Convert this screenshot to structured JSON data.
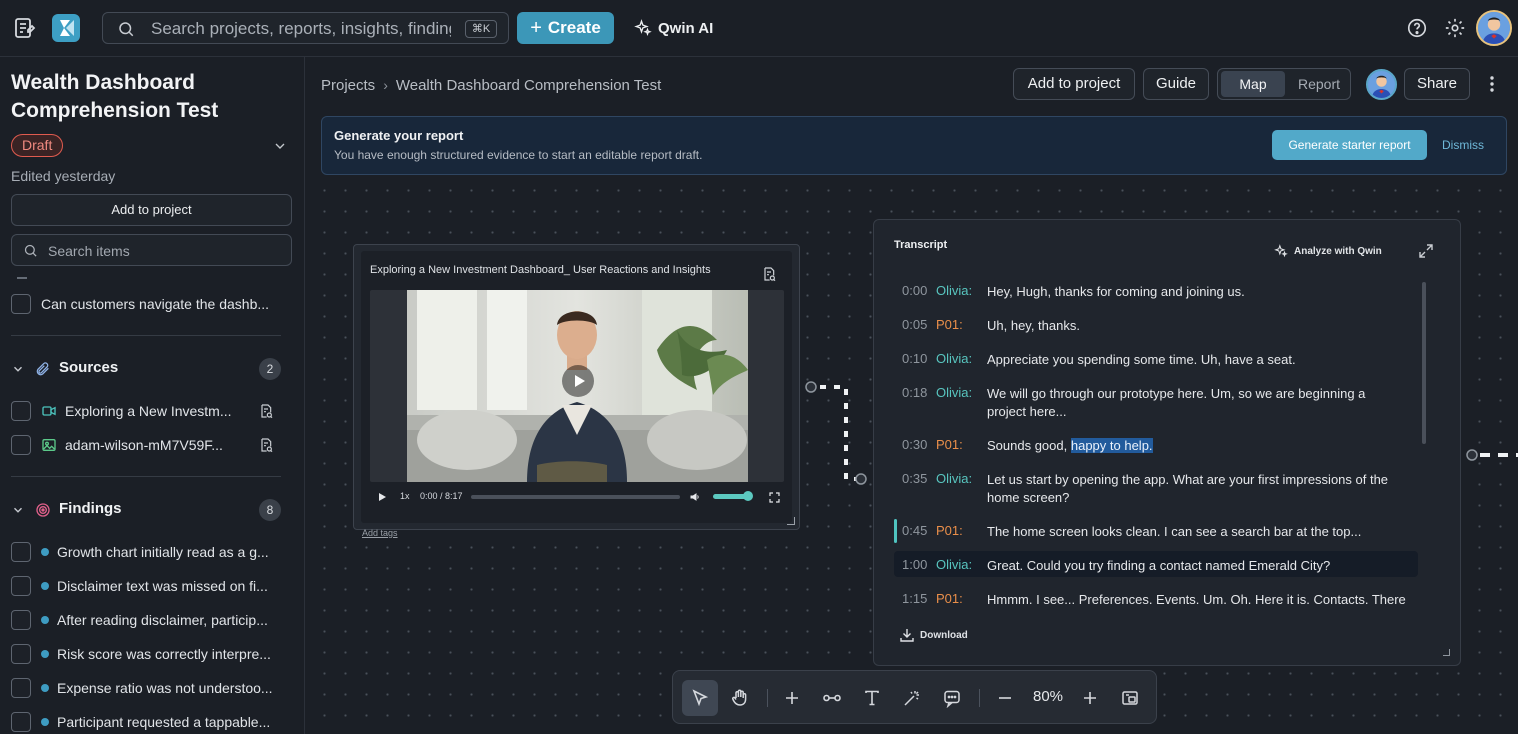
{
  "topbar": {
    "search_placeholder": "Search projects, reports, insights, findings",
    "search_shortcut": "⌘K",
    "create_label": "Create",
    "qwin_label": "Qwin AI"
  },
  "sidebar": {
    "title": "Wealth Dashboard Comprehension Test",
    "status": "Draft",
    "edited": "Edited yesterday",
    "add_to_project": "Add to project",
    "search_placeholder": "Search items",
    "questions": [
      {
        "label": "Can customers navigate the dashb..."
      }
    ],
    "sources": {
      "label": "Sources",
      "count": "2",
      "items": [
        {
          "label": "Exploring a New Investm...",
          "icon": "video-icon"
        },
        {
          "label": "adam-wilson-mM7V59F...",
          "icon": "image-icon"
        }
      ]
    },
    "findings": {
      "label": "Findings",
      "count": "8",
      "items": [
        {
          "label": "Growth chart initially read as a g..."
        },
        {
          "label": "Disclaimer text was missed on fi..."
        },
        {
          "label": "After reading disclaimer, particip..."
        },
        {
          "label": "Risk score was correctly interpre..."
        },
        {
          "label": "Expense ratio was not understoo..."
        },
        {
          "label": "Participant requested a tappable..."
        }
      ]
    }
  },
  "header": {
    "breadcrumb": [
      "Projects",
      "Wealth Dashboard Comprehension Test"
    ],
    "add_to_project": "Add to project",
    "guide": "Guide",
    "view_options": [
      "Map",
      "Report"
    ],
    "active_view": "Map",
    "share": "Share"
  },
  "banner": {
    "title": "Generate your report",
    "subtitle": "You have enough structured evidence to start an editable report draft.",
    "primary": "Generate starter report",
    "dismiss": "Dismiss"
  },
  "video": {
    "title": "Exploring a New Investment Dashboard_ User Reactions and Insights",
    "speed": "1x",
    "time": "0:00 / 8:17",
    "progress": 0,
    "volume": 0.85,
    "add_tags": "Add tags"
  },
  "transcript": {
    "title": "Transcript",
    "analyze": "Analyze with Qwin",
    "download": "Download",
    "rows": [
      {
        "ts": "0:00",
        "speaker": "Olivia:",
        "text": "Hey, Hugh, thanks for coming and joining us."
      },
      {
        "ts": "0:05",
        "speaker": "P01:",
        "text": "Uh, hey, thanks."
      },
      {
        "ts": "0:10",
        "speaker": "Olivia:",
        "text": "Appreciate you spending some time. Uh, have a seat."
      },
      {
        "ts": "0:18",
        "speaker": "Olivia:",
        "text": "We will go through our prototype here. Um, so we are beginning a project here..."
      },
      {
        "ts": "0:30",
        "speaker": "P01:",
        "text_before": "Sounds good, ",
        "text_highlight": "happy to help."
      },
      {
        "ts": "0:35",
        "speaker": "Olivia:",
        "text": "Let us start by opening the app. What are your first impressions of the home screen?"
      },
      {
        "ts": "0:45",
        "speaker": "P01:",
        "text": "The home screen looks clean. I can see a search bar at the top..."
      },
      {
        "ts": "1:00",
        "speaker": "Olivia:",
        "text": "Great. Could you try finding a contact named Emerald City?"
      },
      {
        "ts": "1:15",
        "speaker": "P01:",
        "text": "Hmmm. I see... Preferences. Events. Um. Oh. Here it is. Contacts. There it is."
      }
    ]
  },
  "toolbar": {
    "zoom": "80%"
  },
  "colors": {
    "accent": "#3c97b8",
    "olivia": "#58c5bf",
    "p01": "#ea8f4a",
    "draft": "#e05b4f"
  }
}
